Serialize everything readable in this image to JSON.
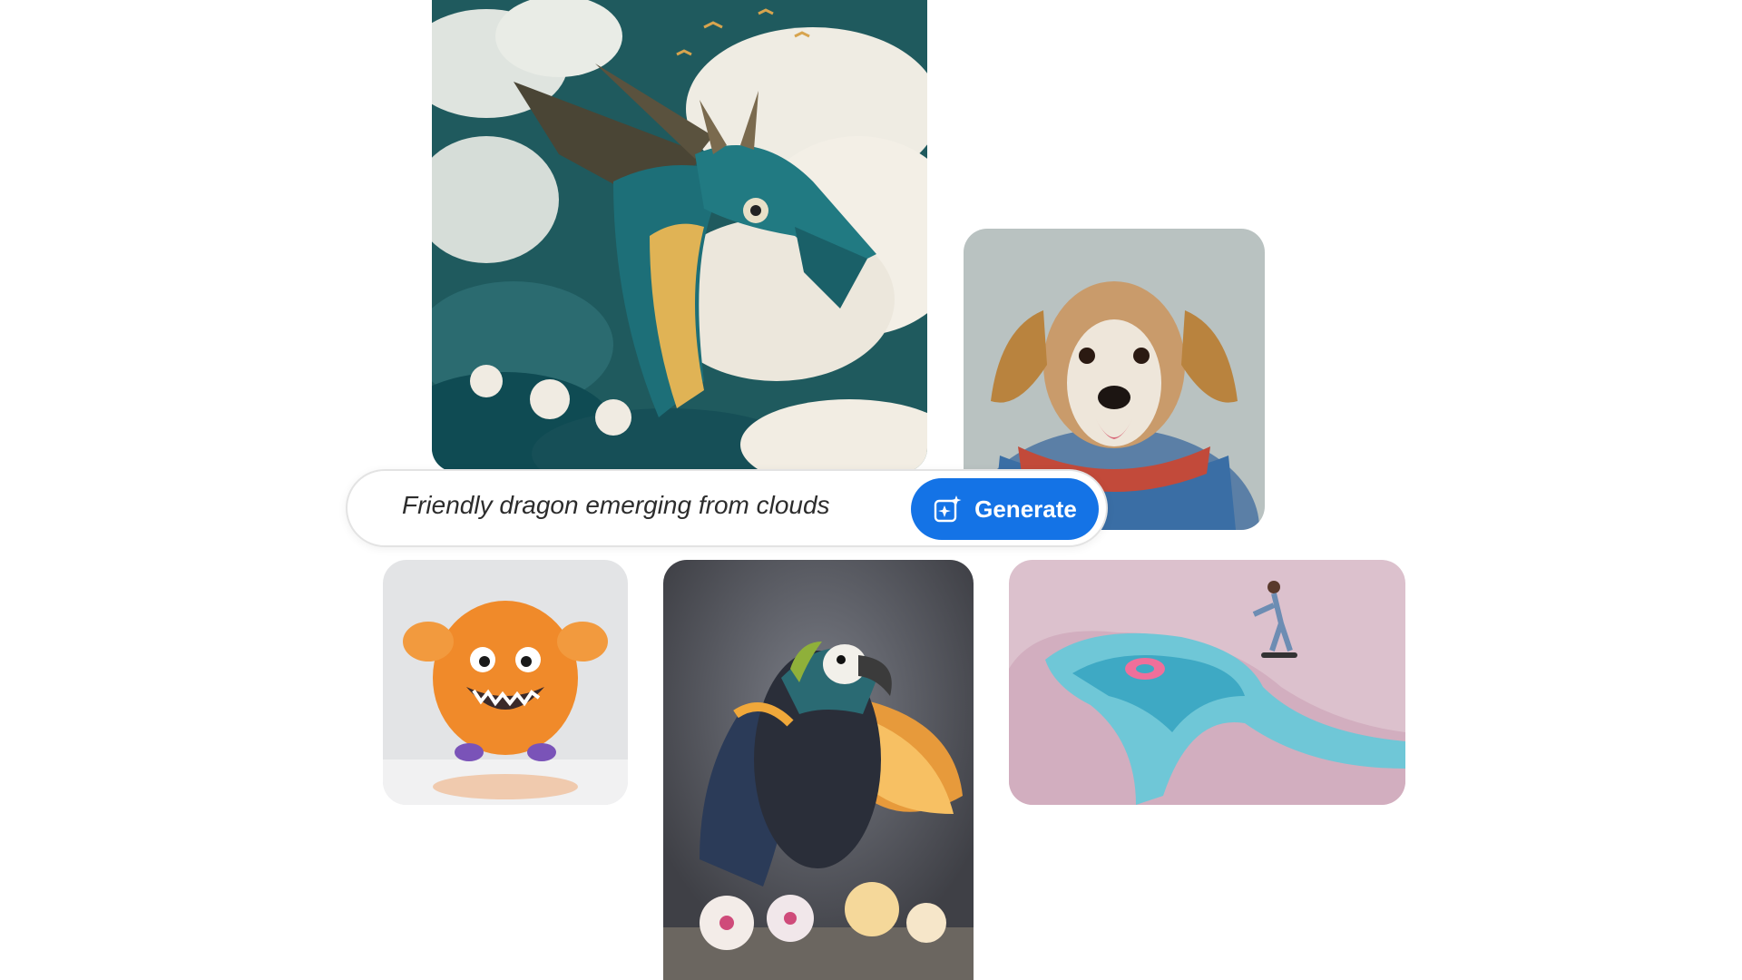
{
  "prompt": {
    "value": "Friendly dragon emerging from clouds"
  },
  "generate_button": {
    "label": "Generate",
    "icon": "sparkle-image-icon",
    "color": "#1473e6"
  },
  "gallery": {
    "items": [
      {
        "subject": "dragon",
        "icon": "dragon-image"
      },
      {
        "subject": "dog",
        "icon": "dog-image"
      },
      {
        "subject": "monster",
        "icon": "monster-image"
      },
      {
        "subject": "parrot",
        "icon": "parrot-image"
      },
      {
        "subject": "skater",
        "icon": "skater-image"
      }
    ]
  }
}
